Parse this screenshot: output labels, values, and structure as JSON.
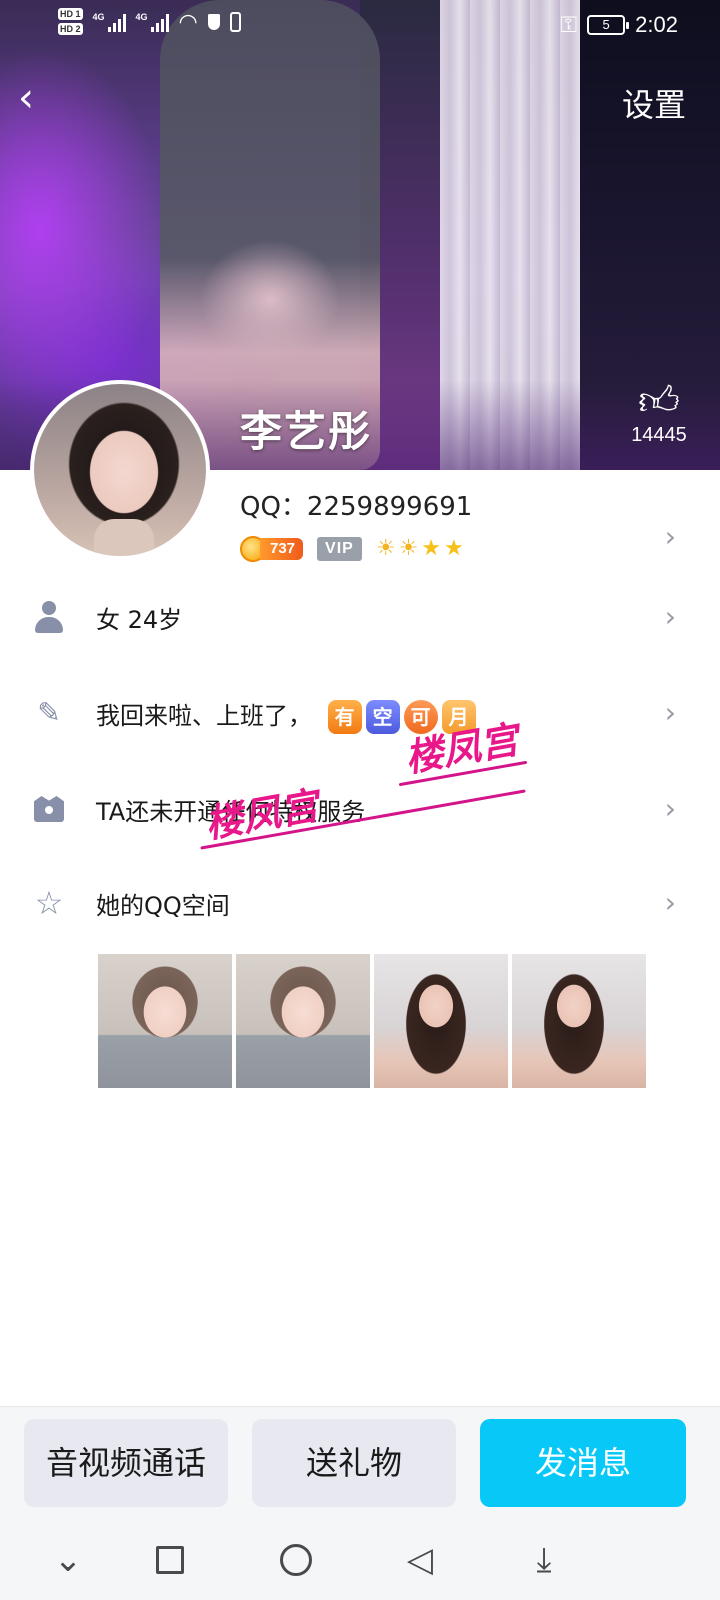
{
  "status_bar": {
    "network_labels": [
      "HD 1",
      "HD 2",
      "4G",
      "4G"
    ],
    "battery": "5",
    "time": "2:02"
  },
  "header": {
    "back_icon": "chevron-left-icon",
    "settings_label": "设置",
    "name": "李艺彤",
    "like_count": "14445"
  },
  "profile": {
    "qq_label": "QQ：2259899691",
    "coin_value": "737",
    "vip_label": "VIP",
    "level_icons": [
      "sun",
      "sun",
      "star",
      "star"
    ]
  },
  "rows": {
    "basic_info": "女  24岁",
    "signature": "我回来啦、上班了，",
    "signature_tags": [
      "有",
      "空",
      "可",
      "月"
    ],
    "privilege": "TA还未开通任何特权服务",
    "qzone": "她的QQ空间"
  },
  "watermark": {
    "text_1": "楼凤宫",
    "text_2": "楼凤宫"
  },
  "actions": {
    "call_label": "音视频通话",
    "gift_label": "送礼物",
    "message_label": "发消息"
  },
  "colors": {
    "accent": "#08c8f8",
    "icon_gray": "#8790a8",
    "watermark": "#e8178a"
  }
}
